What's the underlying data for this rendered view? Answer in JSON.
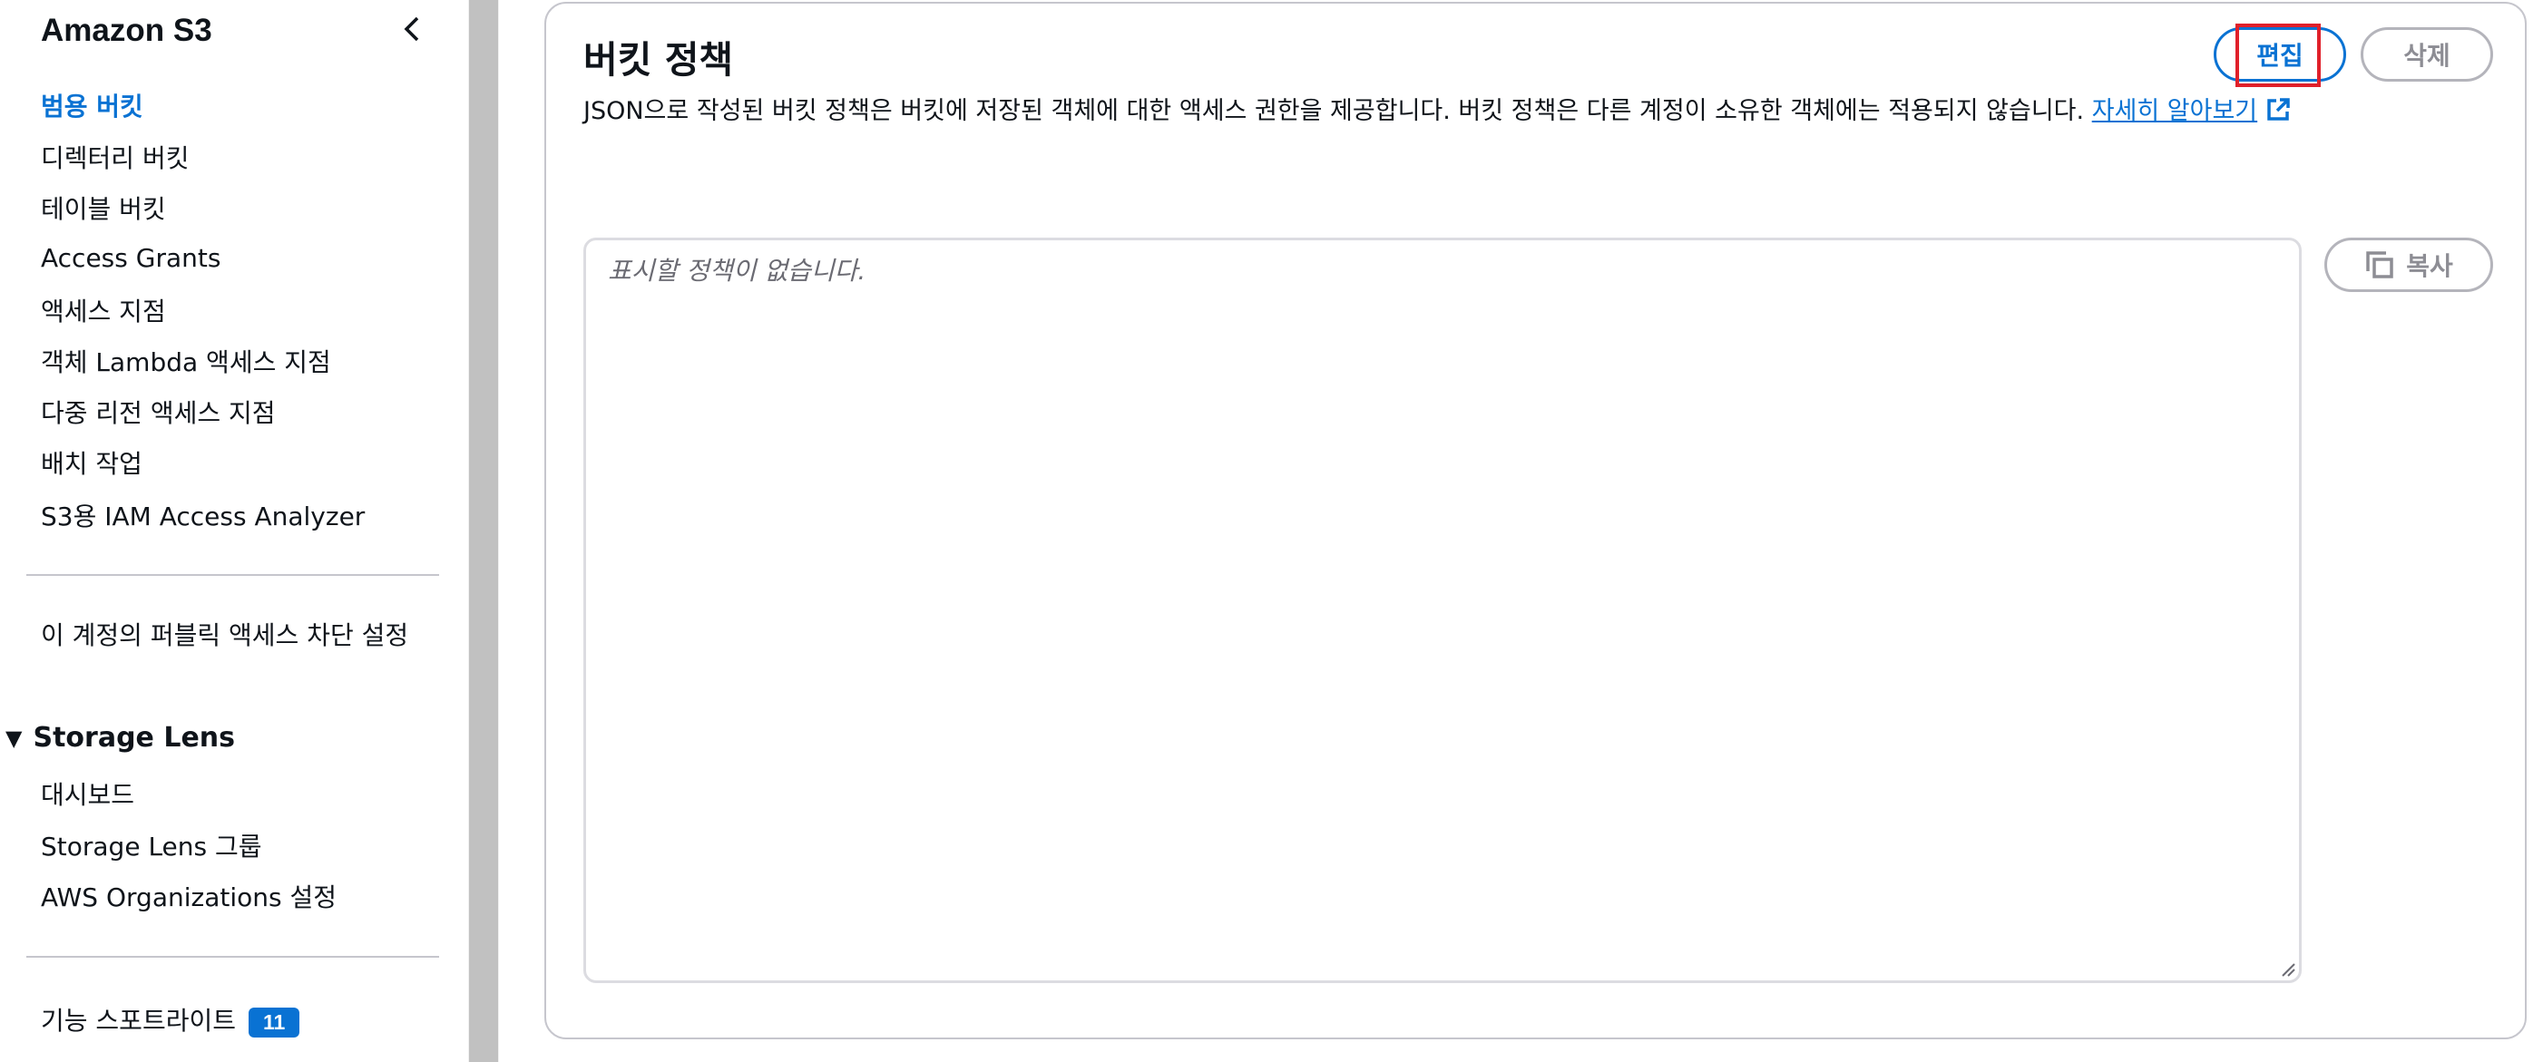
{
  "sidebar": {
    "title": "Amazon S3",
    "nav": [
      {
        "label": "범용 버킷",
        "active": true
      },
      {
        "label": "디렉터리 버킷"
      },
      {
        "label": "테이블 버킷"
      },
      {
        "label": "Access Grants"
      },
      {
        "label": "액세스 지점"
      },
      {
        "label": "객체 Lambda 액세스 지점"
      },
      {
        "label": "다중 리전 액세스 지점"
      },
      {
        "label": "배치 작업"
      },
      {
        "label": "S3용 IAM Access Analyzer"
      }
    ],
    "account_block_label": "이 계정의 퍼블릭 액세스 차단 설정",
    "storage_lens": {
      "label": "Storage Lens",
      "items": [
        "대시보드",
        "Storage Lens 그룹",
        "AWS Organizations 설정"
      ]
    },
    "feature_spotlight": {
      "label": "기능 스포트라이트",
      "badge": "11"
    }
  },
  "policy_panel": {
    "title": "버킷 정책",
    "description": "JSON으로 작성된 버킷 정책은 버킷에 저장된 객체에 대한 액세스 권한을 제공합니다. 버킷 정책은 다른 계정이 소유한 객체에는 적용되지 않습니다.",
    "learn_more": "자세히 알아보기",
    "edit_label": "편집",
    "delete_label": "삭제",
    "copy_label": "복사",
    "empty_text": "표시할 정책이 없습니다."
  },
  "colors": {
    "accent": "#0972d3",
    "highlight": "#e0202a",
    "disabled": "#8d8d94"
  }
}
